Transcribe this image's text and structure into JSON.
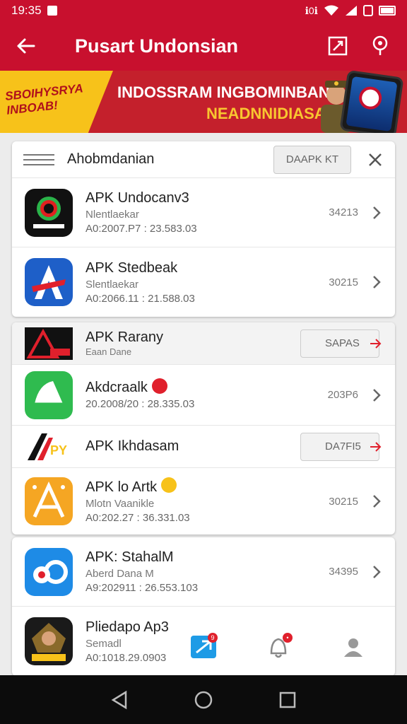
{
  "status_bar": {
    "time": "19:35",
    "signal_text": "ℹ0ℹ"
  },
  "app_bar": {
    "title": "Pusart Undonsian"
  },
  "banner": {
    "left_text": "SBOIHYSRYA INBOAB!",
    "line1": "INDOSSRAM INGBOMINBAN",
    "line2": "NEADNNIDIASAR"
  },
  "list_header": {
    "label": "Ahobmdanian",
    "button": "DAAPK KT"
  },
  "card1": [
    {
      "name": "APK Undocanv3",
      "sub": "Nlentlaekar",
      "date": "A0:2007.P7 : 23.583.03",
      "size": "34213",
      "icon": "brand-logo-dark-icon"
    },
    {
      "name": "APK Stedbeak",
      "sub": "Slentlaekar",
      "date": "A0:2066.11 : 21.588.03",
      "size": "30215",
      "icon": "blue-a-logo-icon"
    }
  ],
  "card2": {
    "featured": {
      "name": "APK Rarany",
      "sub": "Eaan Dane",
      "button": "SAPAS",
      "icon": "dark-triangle-logo-icon"
    },
    "item1": {
      "name": "Akdcraalk",
      "date": "20.2008/20 : 28.335.03",
      "size": "203P6",
      "icon": "green-app-icon"
    },
    "featured2": {
      "name": "APK Ikhdasam",
      "button": "DA7FI5",
      "icon": "apk-logo-icon"
    },
    "item2": {
      "name": "APK lo Artk",
      "sub": "Mlotn Vaanikle",
      "date": "A0:202.27 : 36.331.03",
      "size": "30215",
      "icon": "orange-a-logo-icon"
    }
  },
  "card3": [
    {
      "name": "APK: StahalM",
      "sub": "Aberd Dana M",
      "date": "A9:202911 : 26.553.103",
      "size": "34395",
      "icon": "blue-b-logo-icon"
    },
    {
      "name": "Pliedapo Ap3",
      "sub": "Semadl",
      "date": "A0:1018.29.0903",
      "icon": "game-logo-icon"
    }
  ],
  "bottom_nav": {
    "badge1": "9",
    "badge2": "•"
  },
  "colors": {
    "primary": "#c8102e",
    "accent_yellow": "#f7c21a"
  }
}
